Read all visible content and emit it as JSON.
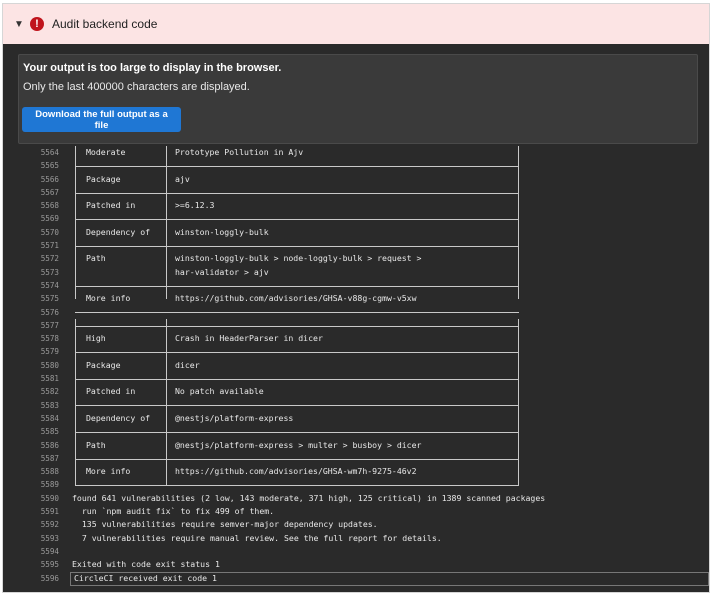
{
  "step": {
    "title": "Audit backend code",
    "status_icon": "fail-icon",
    "colors": {
      "header_bg": "#fce4e4",
      "fail": "#c0141c"
    }
  },
  "notice": {
    "title": "Your output is too large to display in the browser.",
    "subtitle": "Only the last 400000 characters are displayed.",
    "download_label": "Download the full output as a file"
  },
  "log": {
    "lines": [
      {
        "n": "5564",
        "l": "Moderate",
        "r": "Prototype Pollution in Ajv"
      },
      {
        "n": "5565"
      },
      {
        "n": "5566",
        "l": "Package",
        "r": "ajv"
      },
      {
        "n": "5567"
      },
      {
        "n": "5568",
        "l": "Patched in",
        "r": ">=6.12.3"
      },
      {
        "n": "5569"
      },
      {
        "n": "5570",
        "l": "Dependency of",
        "r": "winston-loggly-bulk"
      },
      {
        "n": "5571"
      },
      {
        "n": "5572",
        "l": "Path",
        "r": "winston-loggly-bulk > node-loggly-bulk > request >"
      },
      {
        "n": "5573",
        "r": "har-validator > ajv"
      },
      {
        "n": "5574"
      },
      {
        "n": "5575",
        "l": "More info",
        "r": "https://github.com/advisories/GHSA-v88g-cgmw-v5xw"
      },
      {
        "n": "5576"
      },
      {
        "n": "5577"
      },
      {
        "n": "5578",
        "l": "High",
        "r": "Crash in HeaderParser in dicer"
      },
      {
        "n": "5579"
      },
      {
        "n": "5580",
        "l": "Package",
        "r": "dicer"
      },
      {
        "n": "5581"
      },
      {
        "n": "5582",
        "l": "Patched in",
        "r": "No patch available"
      },
      {
        "n": "5583"
      },
      {
        "n": "5584",
        "l": "Dependency of",
        "r": "@nestjs/platform-express"
      },
      {
        "n": "5585"
      },
      {
        "n": "5586",
        "l": "Path",
        "r": "@nestjs/platform-express > multer > busboy > dicer"
      },
      {
        "n": "5587"
      },
      {
        "n": "5588",
        "l": "More info",
        "r": "https://github.com/advisories/GHSA-wm7h-9275-46v2"
      },
      {
        "n": "5589"
      },
      {
        "n": "5590",
        "t": "found 641 vulnerabilities (2 low, 143 moderate, 371 high, 125 critical) in 1389 scanned packages"
      },
      {
        "n": "5591",
        "t": "  run `npm audit fix` to fix 499 of them."
      },
      {
        "n": "5592",
        "t": "  135 vulnerabilities require semver-major dependency updates."
      },
      {
        "n": "5593",
        "t": "  7 vulnerabilities require manual review. See the full report for details."
      },
      {
        "n": "5594"
      },
      {
        "n": "5595",
        "t": "Exited with code exit status 1"
      },
      {
        "n": "5596",
        "t": "CircleCI received exit code 1"
      }
    ]
  }
}
